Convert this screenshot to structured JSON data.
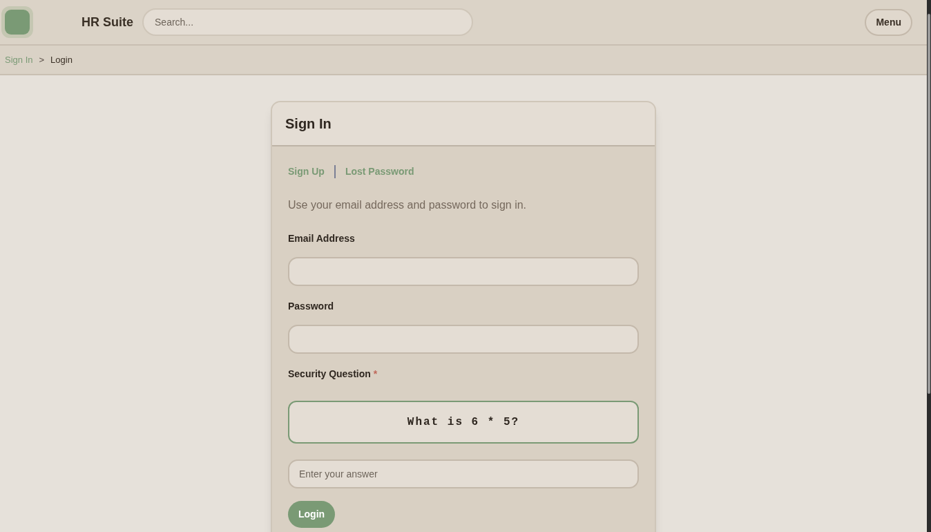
{
  "header": {
    "brand": "HR Suite",
    "search": {
      "placeholder": "Search..."
    },
    "menu_button": "Menu"
  },
  "breadcrumb": [
    {
      "label": "Sign In",
      "kind": "link"
    },
    {
      "label": ">",
      "kind": "separator"
    },
    {
      "label": "Login",
      "kind": "current"
    }
  ],
  "card": {
    "title": "Sign In",
    "links": [
      "Sign Up",
      "Lost Password"
    ],
    "intro": "Use your email address and password to sign in.",
    "fields": [
      {
        "label": "Email Address",
        "required": false
      },
      {
        "label": "Password",
        "required": false
      }
    ],
    "security": {
      "label": "Security Question",
      "required": true,
      "required_mark": "*",
      "question": "What is 6 * 5?",
      "answer": {
        "placeholder": "Enter your answer"
      }
    },
    "submit": "Login"
  }
}
